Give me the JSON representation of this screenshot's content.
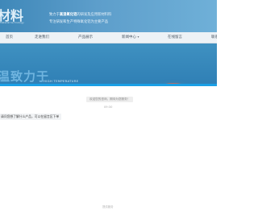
{
  "header": {
    "logo_text": "材料",
    "logo_sub": "Material technology",
    "slogan_line1_prefix": "致力于",
    "slogan_line1_highlight": "高温氧化铝",
    "slogan_line1_suffix": "的研发及应用新材料料",
    "slogan_line2": "专注研发和生产特殊氧化铝为主要产品"
  },
  "nav": {
    "items": [
      {
        "label": "首页"
      },
      {
        "label": "走进我们"
      },
      {
        "label": "产品展示"
      },
      {
        "label": "新闻中心"
      },
      {
        "label": "在线留言"
      },
      {
        "label": "联系"
      }
    ]
  },
  "banner": {
    "title": "温致力于",
    "subtitle_en": "HIGH TEMPERATURE"
  },
  "chat": {
    "system_tip": "欢迎您的咨询，期待为您服务！",
    "time": "09:30",
    "message": "请问您想了解什么产品，可以在留言区下单",
    "powered_by": "提供服务"
  },
  "colors": {
    "header_bg": "#4a93c4",
    "nav_bg": "#edf2f6",
    "banner_bg": "#3a8bbf",
    "accent_bar": "#1aa0e6"
  }
}
